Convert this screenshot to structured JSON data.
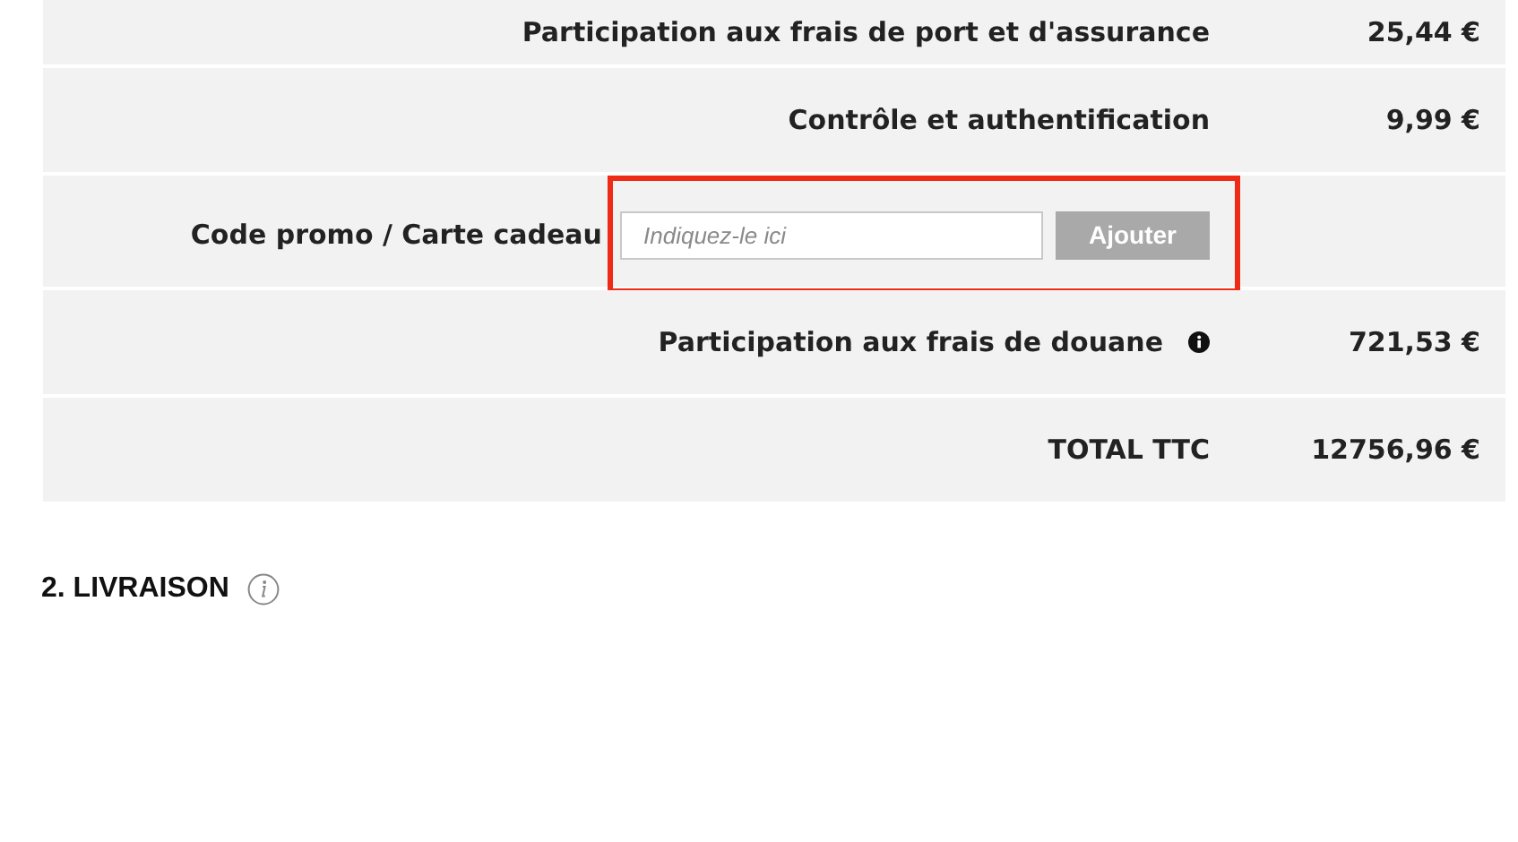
{
  "summary": {
    "rows": [
      {
        "kind": "line",
        "label": "Participation aux frais de port et d'assurance",
        "value": "25,44 €"
      },
      {
        "kind": "line",
        "label": "Contrôle et authentification",
        "value": "9,99 €"
      },
      {
        "kind": "promo",
        "label": "Code promo / Carte cadeau",
        "placeholder": "Indiquez-le ici",
        "button": "Ajouter"
      },
      {
        "kind": "info",
        "label": "Participation aux frais de douane",
        "value": "721,53 €"
      },
      {
        "kind": "total",
        "label": "TOTAL TTC",
        "value": "12756,96 €"
      }
    ]
  },
  "section": {
    "title": "2. LIVRAISON"
  }
}
